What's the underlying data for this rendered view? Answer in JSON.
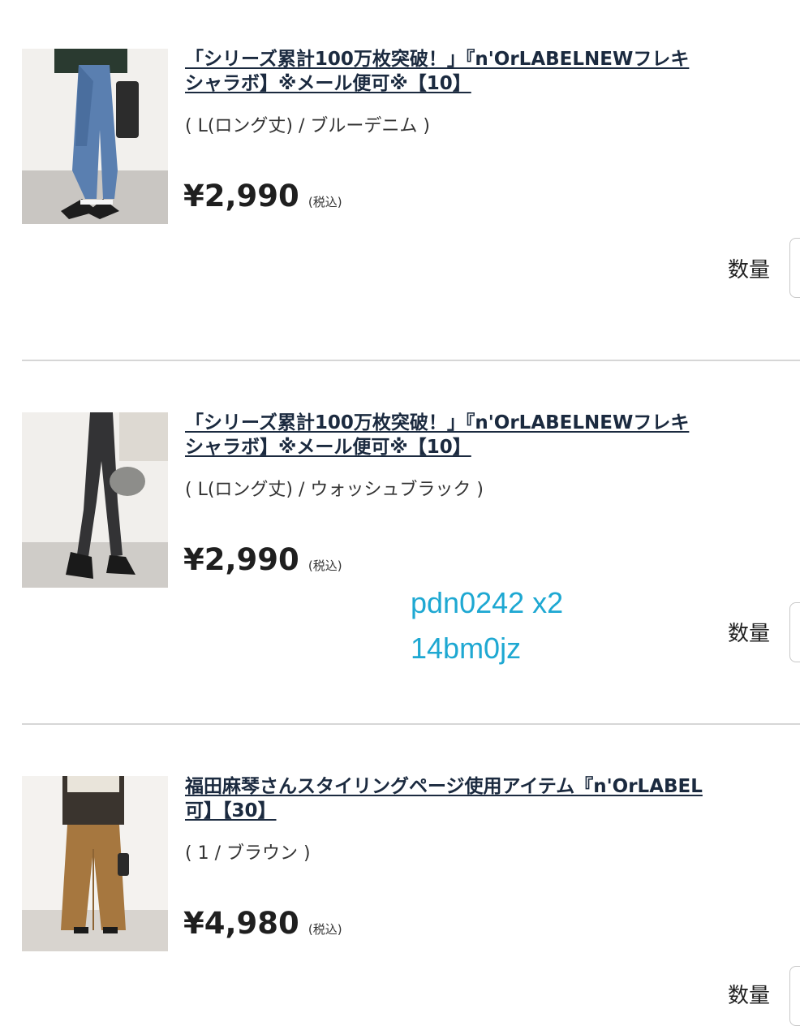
{
  "items": [
    {
      "title_line1": "「シリーズ累計100万枚突破！」『n'OrLABELNEWフレキ",
      "title_line2": "シャラボ】※メール便可※【10】",
      "variant": "( L(ロング丈) / ブルーデニム )",
      "price": "¥2,990",
      "tax_label": "(税込)",
      "qty_label": "数量"
    },
    {
      "title_line1": "「シリーズ累計100万枚突破！」『n'OrLABELNEWフレキ",
      "title_line2": "シャラボ】※メール便可※【10】",
      "variant": "( L(ロング丈) / ウォッシュブラック )",
      "price": "¥2,990",
      "tax_label": "(税込)",
      "qty_label": "数量"
    },
    {
      "title_line1": "福田麻琴さんスタイリングページ使用アイテム『n'OrLABEL",
      "title_line2": "可】【30】",
      "variant": "( 1 / ブラウン )",
      "price": "¥4,980",
      "tax_label": "(税込)",
      "qty_label": "数量"
    }
  ],
  "overlay": {
    "line1": "pdn0242 x2",
    "line2": "14bm0jz"
  },
  "colors": {
    "title": "#1b2a3f",
    "overlay": "#1ea8d2",
    "divider": "#d6d6d6"
  }
}
